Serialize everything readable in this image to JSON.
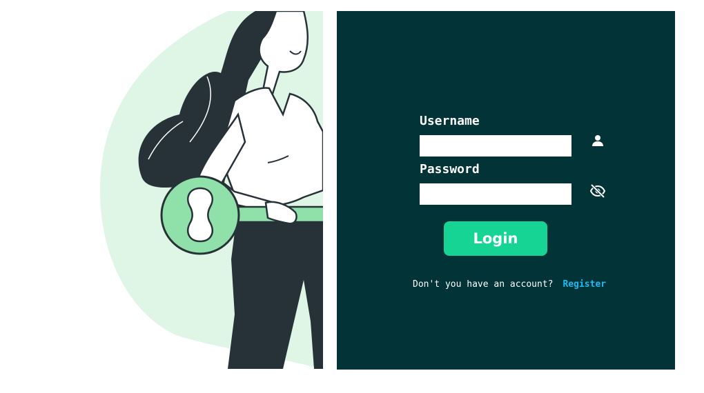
{
  "form": {
    "username_label": "Username",
    "password_label": "Password",
    "username_value": "",
    "password_value": "",
    "login_label": "Login",
    "register_prompt": "Don't you have an account?",
    "register_link": "Register"
  },
  "icons": {
    "username": "user-icon",
    "password": "eye-slash-icon"
  },
  "colors": {
    "panel_bg": "#023337",
    "button_bg": "#16d494",
    "link": "#1fb9f4",
    "illustration_blob": "#dff5e6",
    "key": "#8fe0a9",
    "outline": "#263238"
  }
}
